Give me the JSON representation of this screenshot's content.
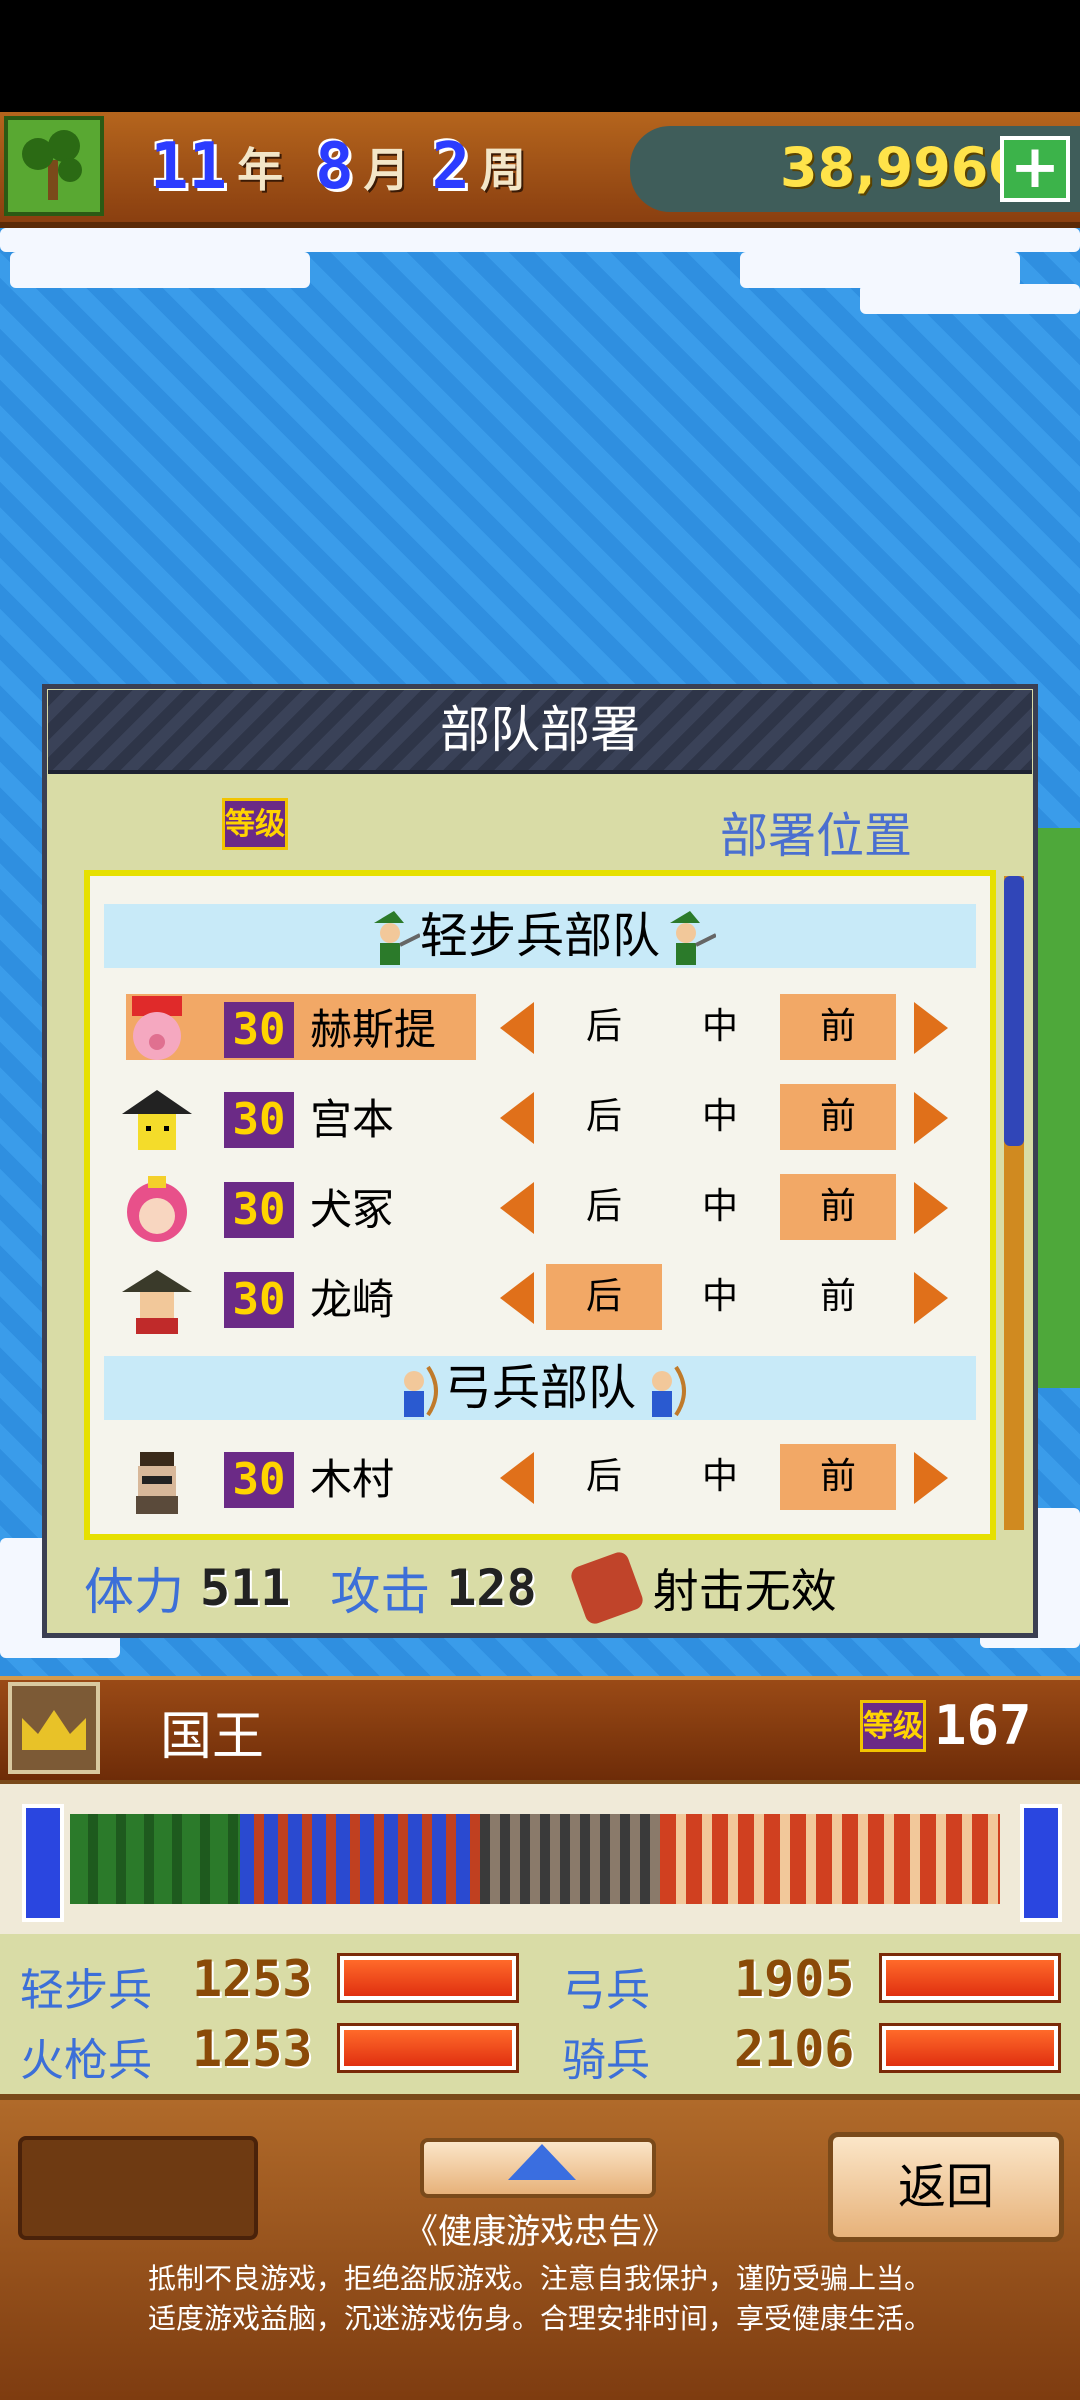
{
  "header": {
    "year": "11",
    "year_unit": "年",
    "month": "8",
    "month_unit": "月",
    "week": "2",
    "week_unit": "周",
    "gold": "38,996G",
    "plus_label": "+"
  },
  "dialog": {
    "title": "部队部署",
    "level_icon_label": "等级",
    "position_header": "部署位置",
    "groups": [
      {
        "title": "轻步兵部队",
        "members": [
          {
            "level": "30",
            "name": "赫斯提",
            "selected": true,
            "positions": [
              "后",
              "中",
              "前"
            ],
            "active": "前"
          },
          {
            "level": "30",
            "name": "宫本",
            "selected": false,
            "positions": [
              "后",
              "中",
              "前"
            ],
            "active": "前"
          },
          {
            "level": "30",
            "name": "犬冢",
            "selected": false,
            "positions": [
              "后",
              "中",
              "前"
            ],
            "active": "前"
          },
          {
            "level": "30",
            "name": "龙崎",
            "selected": false,
            "positions": [
              "后",
              "中",
              "前"
            ],
            "active": "后"
          }
        ]
      },
      {
        "title": "弓兵部队",
        "members": [
          {
            "level": "30",
            "name": "木村",
            "selected": false,
            "positions": [
              "后",
              "中",
              "前"
            ],
            "active": "前"
          }
        ]
      }
    ],
    "stats": {
      "hp_label": "体力",
      "hp_value": "511",
      "attack_label": "攻击",
      "attack_value": "128",
      "effect_text": "射击无效"
    }
  },
  "king": {
    "name": "国王",
    "level_icon_label": "等级",
    "level": "167"
  },
  "troops": [
    {
      "label": "轻步兵",
      "value": "1253",
      "fill": 1.0
    },
    {
      "label": "弓兵",
      "value": "1905",
      "fill": 1.0
    },
    {
      "label": "火枪兵",
      "value": "1253",
      "fill": 1.0
    },
    {
      "label": "骑兵",
      "value": "2106",
      "fill": 1.0
    }
  ],
  "bottom": {
    "back_label": "返回",
    "notice_title": "《健康游戏忠告》",
    "notice_line1": "抵制不良游戏，拒绝盗版游戏。注意自我保护，谨防受骗上当。",
    "notice_line2": "适度游戏益脑，沉迷游戏伤身。合理安排时间，享受健康生活。"
  },
  "colors": {
    "accent_blue": "#3c6fd8",
    "selection_orange": "#f2a866",
    "arrow_orange": "#e0701a",
    "level_purple": "#6b2a86",
    "level_yellow": "#ffd400"
  }
}
